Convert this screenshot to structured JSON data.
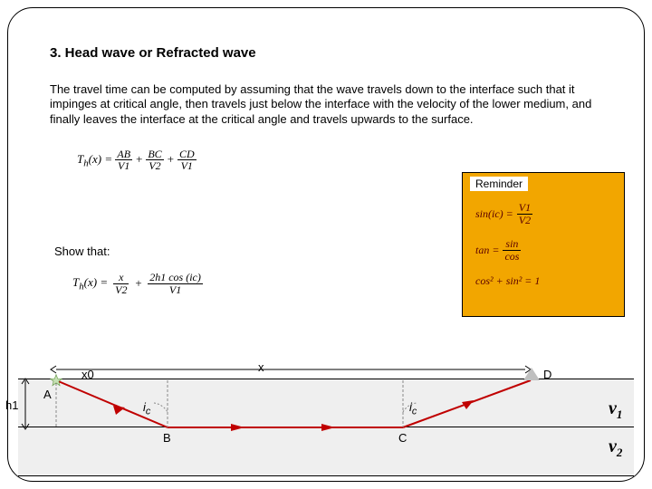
{
  "title": "3. Head wave or Refracted wave",
  "body": "The travel time can be computed by assuming that the wave travels down to the interface such that it impinges at critical angle, then travels just below the interface with the velocity of the lower medium, and finally leaves the interface at the critical angle and travels upwards to the surface.",
  "eq1": {
    "lhs": "T",
    "sub": "h",
    "arg": "(x) =",
    "terms": [
      {
        "num": "AB",
        "den": "V1"
      },
      {
        "num": "BC",
        "den": "V2"
      },
      {
        "num": "CD",
        "den": "V1"
      }
    ]
  },
  "reminder": {
    "label": "Reminder",
    "r1_lhs": "sin(ic) =",
    "r1_num": "V1",
    "r1_den": "V2",
    "r2_lhs": "tan =",
    "r2_num": "sin",
    "r2_den": "cos",
    "r3": "cos² + sin² = 1"
  },
  "showthat": "Show that:",
  "eq2": {
    "lhs": "T",
    "sub": "h",
    "arg": "(x) =",
    "t1_num": "x",
    "t1_den": "V2",
    "t2_num": "2h1 cos (ic)",
    "t2_den": "V1"
  },
  "diagram": {
    "A": "A",
    "B": "B",
    "C": "C",
    "D": "D",
    "x0": "x0",
    "x": "x",
    "h1": "h1",
    "i1": "i",
    "i2": "i",
    "c1": "c",
    "c2": "c",
    "v1": "v",
    "v1s": "1",
    "v2": "v",
    "v2s": "2"
  }
}
